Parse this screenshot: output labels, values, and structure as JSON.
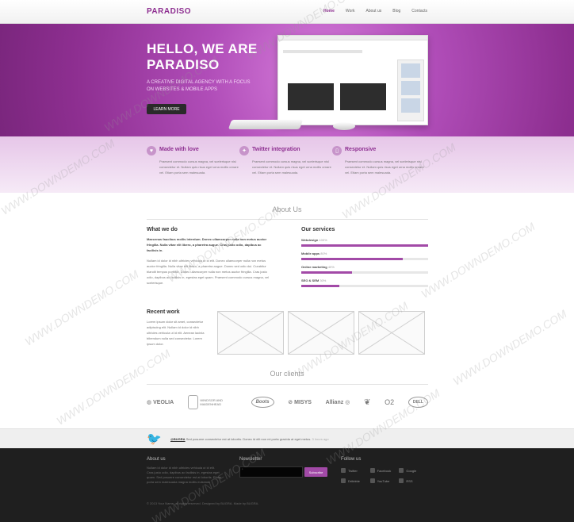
{
  "header": {
    "logo": "PARADISO",
    "nav": [
      "Home",
      "Work",
      "About us",
      "Blog",
      "Contacts"
    ]
  },
  "hero": {
    "title": "HELLO, WE ARE PARADISO",
    "subtitle": "A CREATIVE DIGITAL AGENCY WITH A FOCUS ON WEBSITES & MOBILE APPS",
    "button": "LEARN MORE"
  },
  "features": [
    {
      "title": "Made with love",
      "icon": "heart-icon",
      "text": "Praesent commodo cursus magna, vel scelerisque nisl consectetur et. Nullam quis risus eget urna mollis ornare vel. Etiam porta sem malesuada."
    },
    {
      "title": "Twitter integration",
      "icon": "twitter-bird-icon",
      "text": "Praesent commodo cursus magna, vel scelerisque nisl consectetur et. Nullam quis risus eget urna mollis ornare vel. Etiam porta sem malesuada."
    },
    {
      "title": "Responsive",
      "icon": "device-icon",
      "text": "Praesent commodo cursus magna, vel scelerisque nisl consectetur et. Nullam quis risus eget urna mollis ornare vel. Etiam porta sem malesuada."
    }
  ],
  "about": {
    "title": "About Us",
    "what_title": "What we do",
    "what_lead": "Maecenas faucibus mollis interdum. Donec ullamcorper nulla non metus auctor fringilla. Nulla vitae elit libero, a pharetra augue. Cras justo odio, dapibus ac facilisis in.",
    "what_text": "Nullam id dolor id nibh ultricies vehicula ut id elit. Donec ullamcorper nulla non metus auctor fringilla. Nulla vitae elit libero, a pharetra augue. Donec sed odio dui. Curabitur blandit tempus porttitor. Donec ullamcorper nulla non metus auctor fringilla. Cras justo odio, dapibus ac facilisis in, egestas eget quam. Praesent commodo cursus magna, vel scelerisque.",
    "services_title": "Our services",
    "skills": [
      {
        "label": "Webdesign",
        "value": "100%",
        "fraction": 1.0
      },
      {
        "label": "Mobile apps",
        "value": "80%",
        "fraction": 0.8
      },
      {
        "label": "Online marketing",
        "value": "40%",
        "fraction": 0.4
      },
      {
        "label": "SEO & SEM",
        "value": "30%",
        "fraction": 0.3
      }
    ],
    "recent_title": "Recent work",
    "recent_text": "Lorem ipsum dolor sit amet, consectetur adipiscing elit. Nullam id dolor id nibh ultricies vehicula ut id elit. Aenean lacinia bibendum nulla sed consectetur. Lorem ipsum dolor."
  },
  "clients": {
    "title": "Our clients",
    "logos": [
      "VEOLIA",
      "WINDSOR AND MAIDENHEAD",
      "Boots",
      "MISYS",
      "Allianz",
      "O2",
      "DELL"
    ]
  },
  "tweet": {
    "handle": "@BUGRA",
    "text": "Sed posuere consectetur est at lobortis. Donec id elit non mi porta gravida at eget metus.",
    "time": "3 hours ago"
  },
  "footer": {
    "about_title": "About us",
    "about_text": "Nullam id dolor id nibh ultricies vehicula ut id elit. Cras justo odio, dapibus ac facilisis in, egestas eget quam. Sed posuere consectetur est at lobortis. Etiam porta sem malesuada magna mollis euismod.",
    "news_title": "Newsletter",
    "news_button": "Subscribe",
    "follow_title": "Follow us",
    "social": [
      "Twitter",
      "Facebook",
      "Google",
      "Dribbble",
      "YouTube",
      "RSS"
    ],
    "copyright": "© 2013 Your Name, all rights reserved. Designed by BUGRA. Made by BUGRA."
  },
  "watermark": "WWW.DOWNDEMO.COM"
}
